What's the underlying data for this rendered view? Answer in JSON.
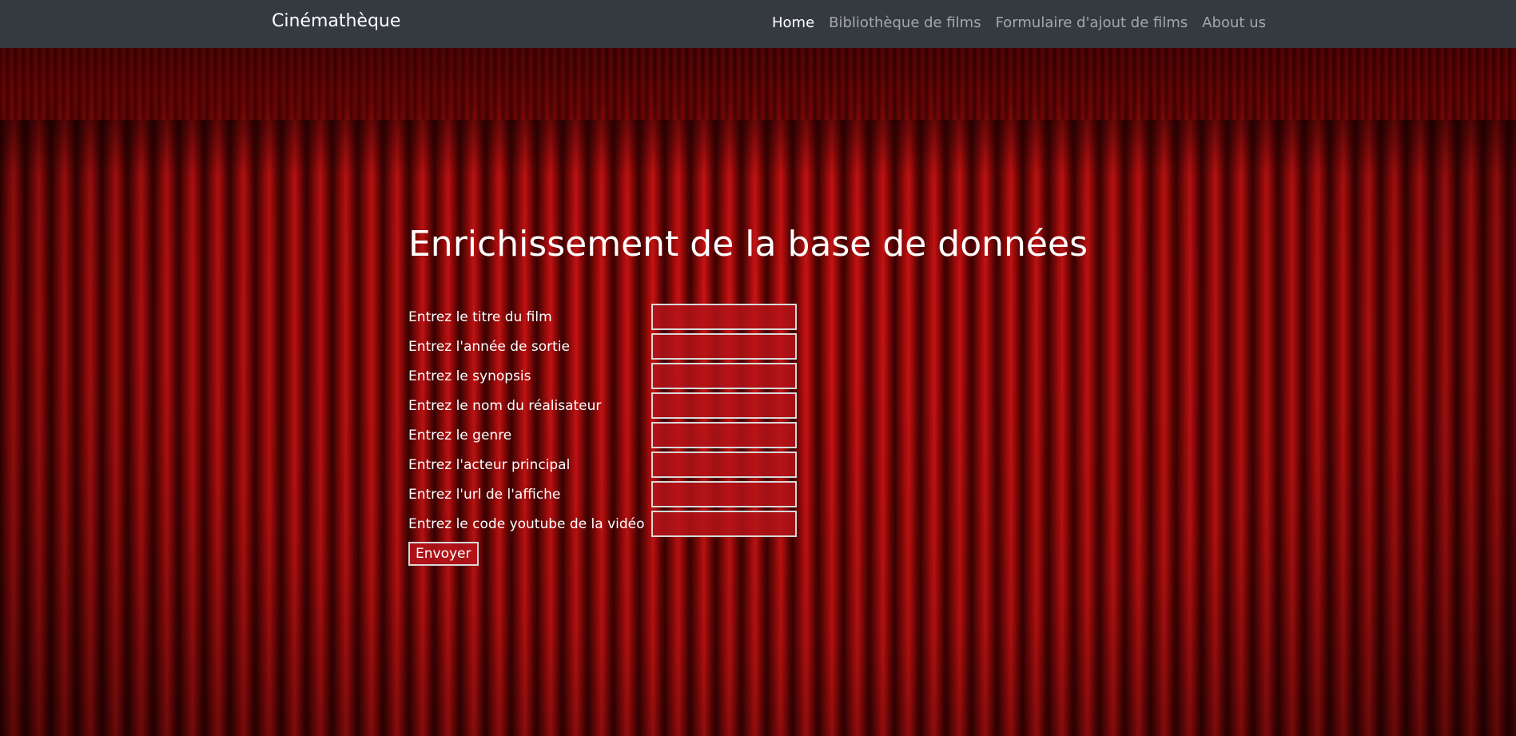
{
  "navbar": {
    "brand": "Cinémathèque",
    "links": [
      {
        "label": "Home",
        "active": true
      },
      {
        "label": "Bibliothèque de films",
        "active": false
      },
      {
        "label": "Formulaire d'ajout de films",
        "active": false
      },
      {
        "label": "About us",
        "active": false
      }
    ]
  },
  "main": {
    "title": "Enrichissement de la base de données",
    "fields": [
      {
        "label": "Entrez le titre du film",
        "value": ""
      },
      {
        "label": "Entrez l'année de sortie",
        "value": ""
      },
      {
        "label": "Entrez le synopsis",
        "value": ""
      },
      {
        "label": "Entrez le nom du réalisateur",
        "value": ""
      },
      {
        "label": "Entrez le genre",
        "value": ""
      },
      {
        "label": "Entrez l'acteur principal",
        "value": ""
      },
      {
        "label": "Entrez l'url de l'affiche",
        "value": ""
      },
      {
        "label": "Entrez le code youtube de la vidéo",
        "value": ""
      }
    ],
    "submit_label": "Envoyer"
  },
  "colors": {
    "navbar_bg": "#343a40",
    "curtain_red": "#b20d0d",
    "input_bg": "#b41419",
    "text": "#ffffff"
  }
}
